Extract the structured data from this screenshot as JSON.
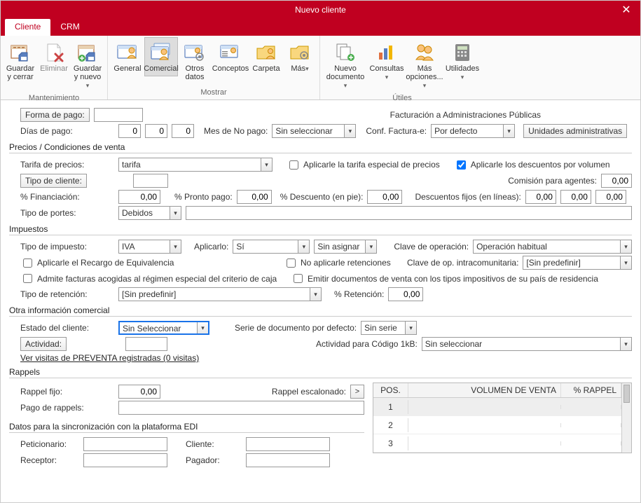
{
  "window": {
    "title": "Nuevo cliente"
  },
  "tabs": [
    {
      "label": "Cliente",
      "active": "1"
    },
    {
      "label": "CRM",
      "active": ""
    }
  ],
  "ribbon": {
    "groups": [
      {
        "label": "Mantenimiento",
        "buttons": [
          {
            "name": "save-close",
            "line1": "Guardar",
            "line2": "y cerrar",
            "drop": ""
          },
          {
            "name": "delete",
            "line1": "Eliminar",
            "line2": "",
            "drop": "",
            "disabled": "1"
          },
          {
            "name": "save-new",
            "line1": "Guardar",
            "line2": "y nuevo",
            "drop": "▾"
          }
        ]
      },
      {
        "label": "Mostrar",
        "buttons": [
          {
            "name": "general",
            "line1": "General",
            "line2": "",
            "drop": ""
          },
          {
            "name": "comercial",
            "line1": "Comercial",
            "line2": "",
            "drop": "",
            "active": "1"
          },
          {
            "name": "otros-datos",
            "line1": "Otros",
            "line2": "datos",
            "drop": ""
          },
          {
            "name": "conceptos",
            "line1": "Conceptos",
            "line2": "",
            "drop": ""
          },
          {
            "name": "carpeta",
            "line1": "Carpeta",
            "line2": "",
            "drop": ""
          },
          {
            "name": "mas",
            "line1": "Más",
            "line2": "",
            "drop": "▾"
          }
        ]
      },
      {
        "label": "Útiles",
        "buttons": [
          {
            "name": "nuevo-documento",
            "line1": "Nuevo",
            "line2": "documento",
            "drop": "▾",
            "wide": "1"
          },
          {
            "name": "consultas",
            "line1": "Consultas",
            "line2": "",
            "drop": "▾"
          },
          {
            "name": "mas-opciones",
            "line1": "Más",
            "line2": "opciones...",
            "drop": "▾"
          },
          {
            "name": "utilidades",
            "line1": "Utilidades",
            "line2": "",
            "drop": "▾"
          }
        ]
      }
    ]
  },
  "form": {
    "forma_pago_label": "Forma de pago:",
    "forma_pago_value": "",
    "factur_ap_label": "Facturación a Administraciones Públicas",
    "dias_pago_label": "Días de pago:",
    "dias_pago_v1": "0",
    "dias_pago_v2": "0",
    "dias_pago_v3": "0",
    "mes_no_pago_label": "Mes de No pago:",
    "mes_no_pago_value": "Sin seleccionar",
    "conf_factura_label": "Conf. Factura-e:",
    "conf_factura_value": "Por defecto",
    "unidades_btn": "Unidades administrativas",
    "sec_precios": "Precios / Condiciones de venta",
    "tarifa_label": "Tarifa de precios:",
    "tarifa_value": "tarifa",
    "tarifa_chk": "Aplicarle la tarifa especial de precios",
    "desc_vol_chk": "Aplicarle los descuentos por volumen",
    "tipo_cliente_btn": "Tipo de cliente:",
    "tipo_cliente_value": "",
    "comision_label": "Comisión para agentes:",
    "comision_value": "0,00",
    "financiacion_label": "% Financiación:",
    "financiacion_value": "0,00",
    "pronto_pago_label": "% Pronto pago:",
    "pronto_pago_value": "0,00",
    "desc_pie_label": "% Descuento (en pie):",
    "desc_pie_value": "0,00",
    "desc_fijos_label": "Descuentos fijos (en líneas):",
    "desc_fijos_v1": "0,00",
    "desc_fijos_v2": "0,00",
    "desc_fijos_v3": "0,00",
    "tipo_portes_label": "Tipo de portes:",
    "tipo_portes_value": "Debidos",
    "tipo_portes_note": "",
    "sec_impuestos": "Impuestos",
    "tipo_impuesto_label": "Tipo de impuesto:",
    "tipo_impuesto_value": "IVA",
    "aplicarlo_label": "Aplicarlo:",
    "aplicarlo_value": "Sí",
    "sin_asignar_value": "Sin asignar",
    "clave_op_label": "Clave de operación:",
    "clave_op_value": "Operación habitual",
    "recargo_chk": "Aplicarle el Recargo de Equivalencia",
    "no_retenciones_chk": "No aplicarle retenciones",
    "clave_intra_label": "Clave de op. intracomunitaria:",
    "clave_intra_value": "[Sin predefinir]",
    "criterio_caja_chk": "Admite facturas acogidas al régimen especial del criterio de caja",
    "emitir_doc_chk": "Emitir documentos de venta con los tipos impositivos de su país de residencia",
    "tipo_reten_label": "Tipo de retención:",
    "tipo_reten_value": "[Sin predefinir]",
    "pct_reten_label": "% Retención:",
    "pct_reten_value": "0,00",
    "sec_otra": "Otra información comercial",
    "estado_label": "Estado del cliente:",
    "estado_value": "Sin Seleccionar",
    "serie_label": "Serie de documento por defecto:",
    "serie_value": "Sin serie",
    "actividad_btn": "Actividad:",
    "actividad_value": "",
    "actividad_1kb_label": "Actividad para Código 1kB:",
    "actividad_1kb_value": "Sin seleccionar",
    "preventa_link": "Ver visitas de PREVENTA registradas (0 visitas)",
    "sec_rappels": "Rappels",
    "rappel_fijo_label": "Rappel fijo:",
    "rappel_fijo_value": "0,00",
    "rappel_esc_label": "Rappel escalonado:",
    "pago_rappels_label": "Pago de rappels:",
    "pago_rappels_value": "",
    "rtable_h1": "POS.",
    "rtable_h2": "VOLUMEN DE VENTA",
    "rtable_h3": "% RAPPEL",
    "rrows": [
      {
        "pos": "1",
        "vol": "",
        "rap": ""
      },
      {
        "pos": "2",
        "vol": "",
        "rap": ""
      },
      {
        "pos": "3",
        "vol": "",
        "rap": ""
      }
    ],
    "sec_edi": "Datos para la sincronización con la plataforma EDI",
    "peticionario_label": "Peticionario:",
    "peticionario_value": "",
    "cliente_label": "Cliente:",
    "cliente_value": "",
    "receptor_label": "Receptor:",
    "receptor_value": "",
    "pagador_label": "Pagador:",
    "pagador_value": ""
  }
}
